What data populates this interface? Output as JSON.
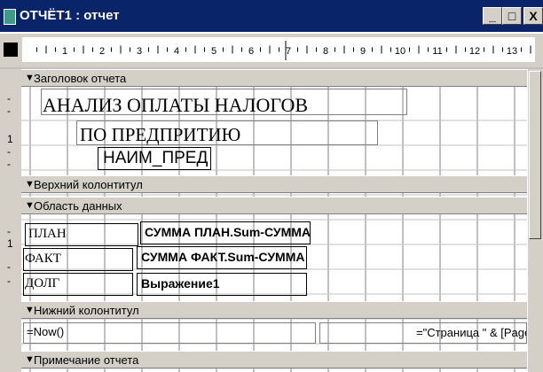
{
  "window": {
    "title": "ОТЧЁТ1 : отчет",
    "controls": [
      "_",
      "□",
      "X"
    ]
  },
  "ruler": {
    "numbers": [
      "1",
      "2",
      "3",
      "4",
      "5",
      "6",
      "7",
      "8",
      "9",
      "10",
      "11",
      "12",
      "13"
    ]
  },
  "sections": {
    "report_header": "Заголовок отчета",
    "page_header": "Верхний колонтитул",
    "detail": "Область данных",
    "page_footer": "Нижний колонтитул",
    "report_footer": "Примечание отчета"
  },
  "report_header_controls": {
    "title_line1": "АНАЛИЗ ОПЛАТЫ НАЛОГОВ",
    "title_line2": "ПО ПРЕДПРИТИЮ",
    "name_field": "НАИМ_ПРЕД"
  },
  "detail_controls": {
    "labels": [
      "ПЛАН",
      "ФАКТ",
      "ДОЛГ"
    ],
    "fields": [
      "СУММА ПЛАН.Sum-СУММА",
      "СУММА ФАКТ.Sum-СУММА",
      "Выражение1"
    ]
  },
  "footer_controls": {
    "date_expr": "=Now()",
    "page_expr": "=\"Страница \" & [Page] &"
  },
  "left_ruler_marks": [
    "-",
    "-",
    "1",
    "-",
    "-",
    "-",
    "1",
    "-",
    "-"
  ]
}
